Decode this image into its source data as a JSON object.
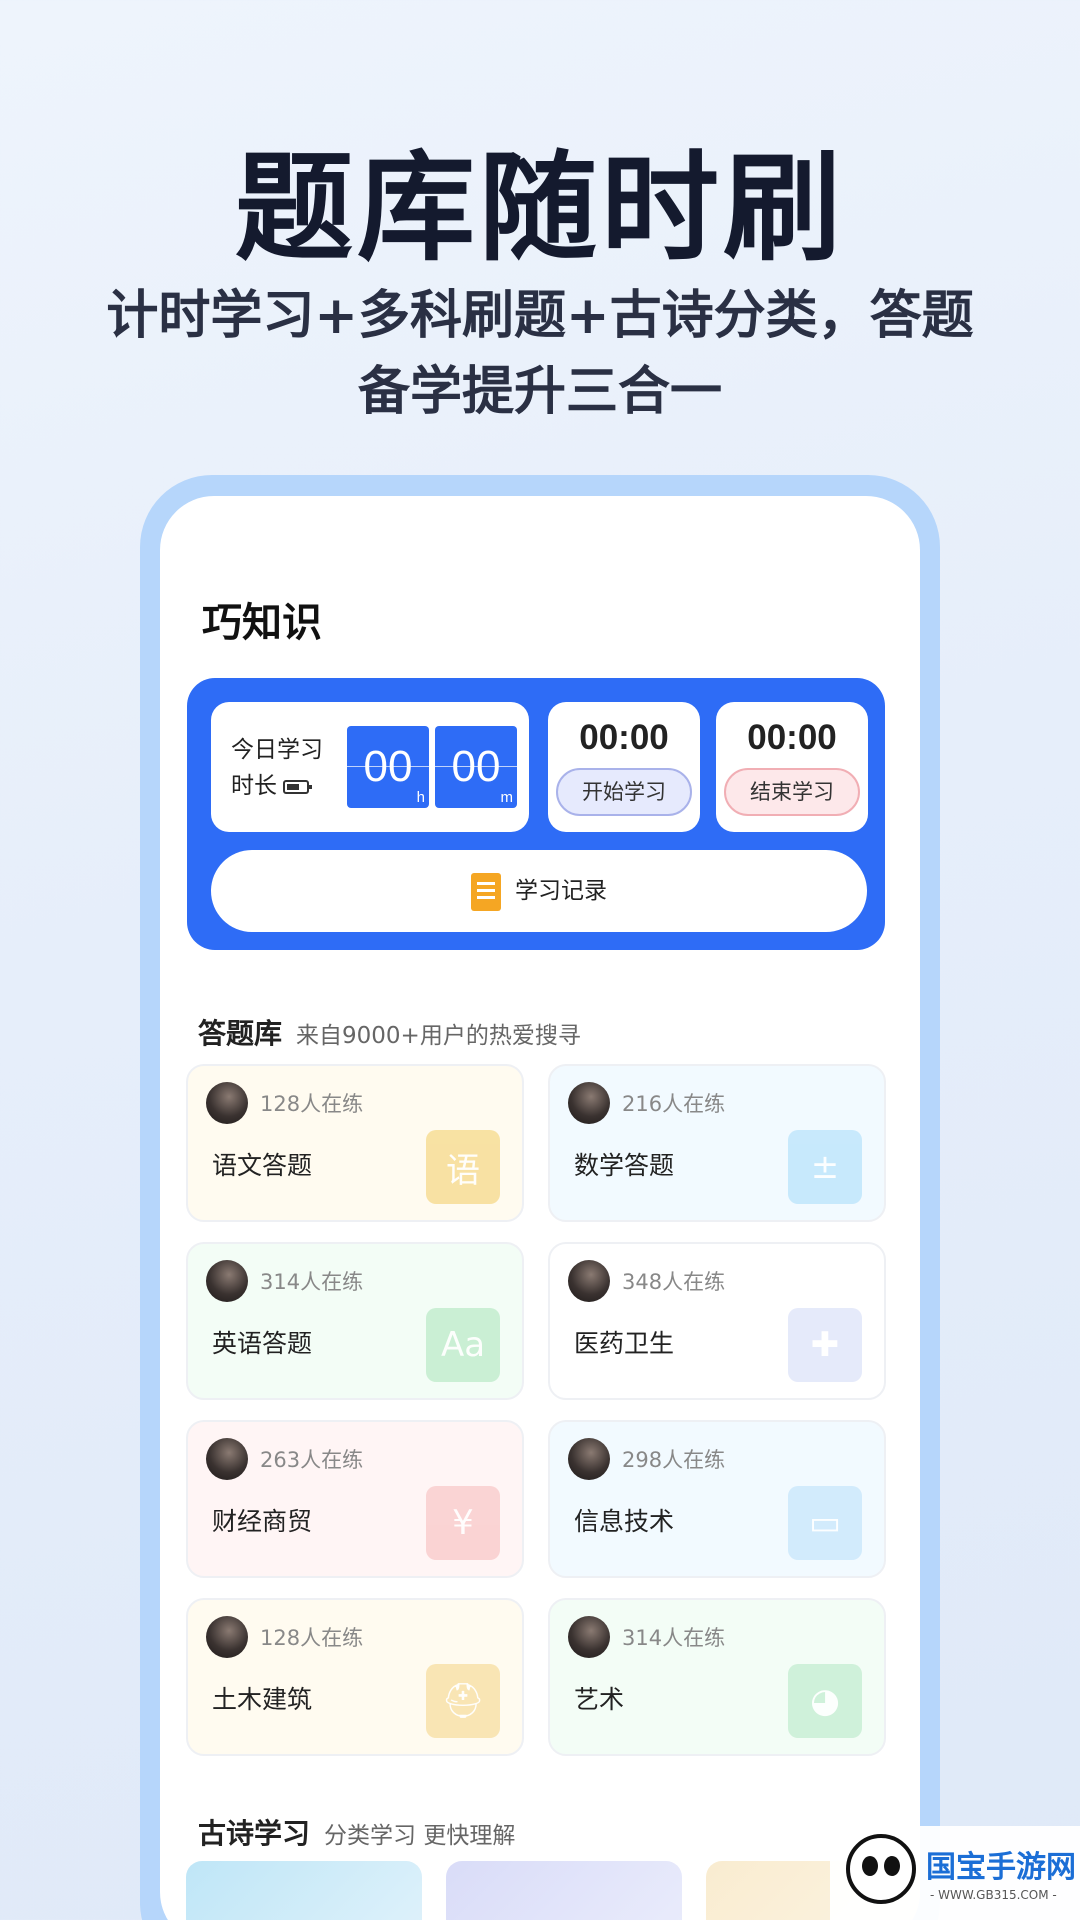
{
  "hero": {
    "title": "题库随时刷",
    "subtitle_line1": "计时学习+多科刷题+古诗分类，答题",
    "subtitle_line2": "备学提升三合一"
  },
  "app": {
    "title": "巧知识"
  },
  "timer": {
    "today_label_line1": "今日学习",
    "today_label_line2": "时长",
    "hours": "00",
    "hours_unit": "h",
    "minutes": "00",
    "minutes_unit": "m",
    "start_clock": "00:00",
    "start_label": "开始学习",
    "end_clock": "00:00",
    "end_label": "结束学习",
    "record_label": "学习记录"
  },
  "question_bank": {
    "title": "答题库",
    "subtitle": "来自9000+用户的热爱搜寻",
    "subjects": [
      {
        "count": "128人在练",
        "name": "语文答题",
        "icon": "book-icon",
        "glyph": "语",
        "bg": "#fffbf0",
        "accent": "#f6d98a"
      },
      {
        "count": "216人在练",
        "name": "数学答题",
        "icon": "calculator-icon",
        "glyph": "±",
        "bg": "#f2faff",
        "accent": "#b9e3fb"
      },
      {
        "count": "314人在练",
        "name": "英语答题",
        "icon": "letters-icon",
        "glyph": "Aa",
        "bg": "#f3fdf6",
        "accent": "#bdebc9"
      },
      {
        "count": "348人在练",
        "name": "医药卫生",
        "icon": "medkit-icon",
        "glyph": "✚",
        "bg": "#ffffff",
        "accent": "#dde3f9"
      },
      {
        "count": "263人在练",
        "name": "财经商贸",
        "icon": "coin-icon",
        "glyph": "¥",
        "bg": "#fff5f5",
        "accent": "#f9c8c8"
      },
      {
        "count": "298人在练",
        "name": "信息技术",
        "icon": "monitor-icon",
        "glyph": "▭",
        "bg": "#f2faff",
        "accent": "#c7e6fb"
      },
      {
        "count": "128人在练",
        "name": "土木建筑",
        "icon": "worker-icon",
        "glyph": "⛑",
        "bg": "#fffbf0",
        "accent": "#f7dea0"
      },
      {
        "count": "314人在练",
        "name": "艺术",
        "icon": "palette-icon",
        "glyph": "◕",
        "bg": "#f3fdf6",
        "accent": "#c3ecd0"
      }
    ]
  },
  "poetry": {
    "title": "古诗学习",
    "subtitle": "分类学习 更快理解"
  },
  "watermark": {
    "name": "国宝手游网",
    "url": "- WWW.GB315.COM -"
  }
}
